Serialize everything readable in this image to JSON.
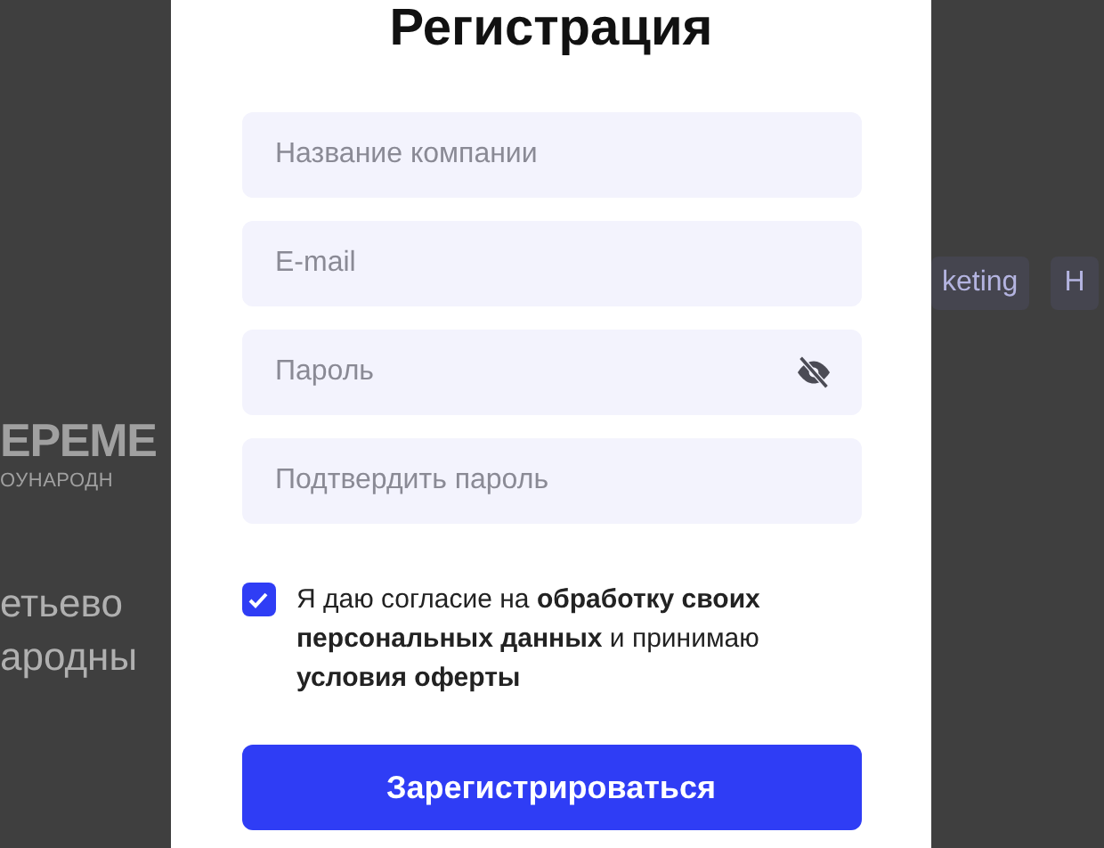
{
  "background": {
    "logo_main": "ЕРЕМЕ",
    "logo_sub": "ОУНАРОДН",
    "heading_lines": [
      "етьево",
      "ародны"
    ],
    "tags": [
      "keting",
      "H"
    ]
  },
  "modal": {
    "title": "Регистрация",
    "fields": [
      {
        "placeholder": "Название компании",
        "kind": "text"
      },
      {
        "placeholder": "E-mail",
        "kind": "email"
      },
      {
        "placeholder": "Пароль",
        "kind": "password"
      },
      {
        "placeholder": "Подтвердить пароль",
        "kind": "text"
      }
    ],
    "consent": {
      "checked": true,
      "text": "Я даю согласие на **обработку своих персональных данных** и принимаю **условия оферты**"
    },
    "submit": "Зарегистрироваться"
  }
}
